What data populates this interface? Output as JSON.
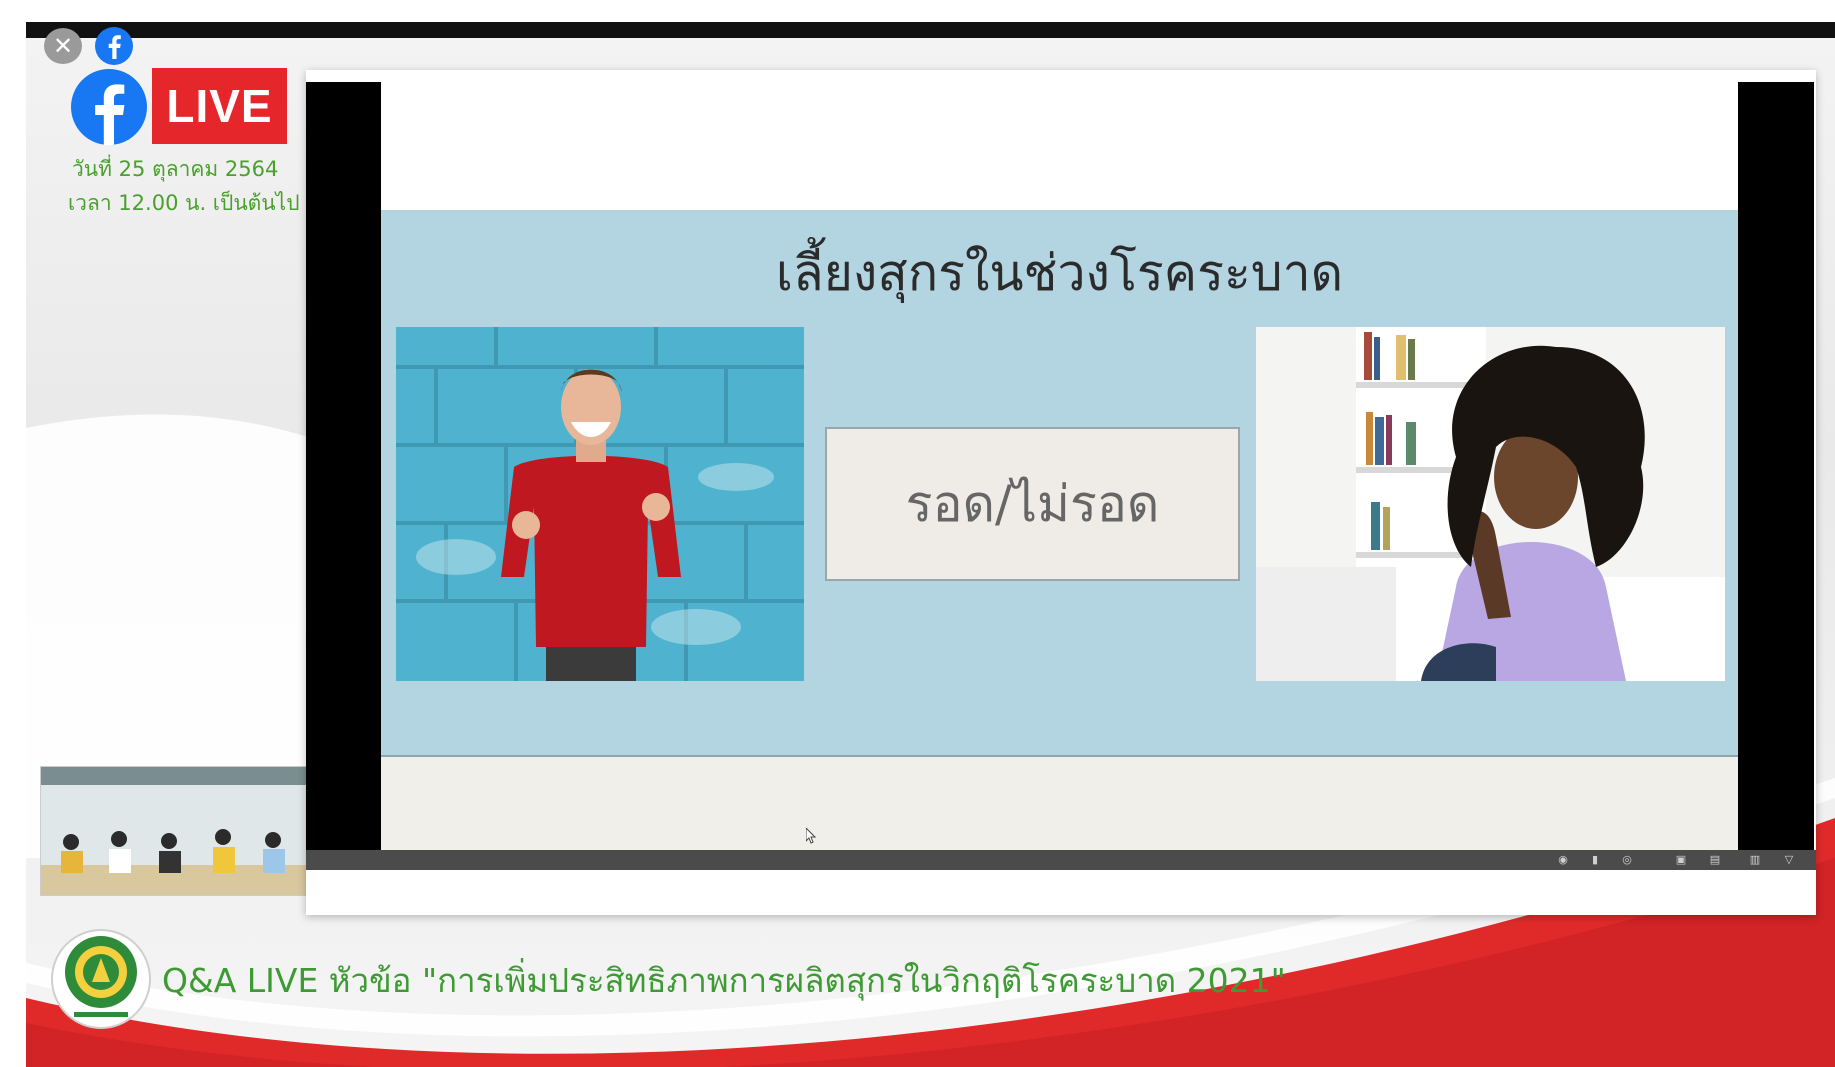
{
  "overlay": {
    "close_glyph": "✕",
    "live_badge": "LIVE",
    "date_line_1": "วันที่ 25 ตุลาคม 2564",
    "date_line_2": "เวลา 12.00 น. เป็นต้นไป",
    "colors": {
      "facebook_blue": "#1877f2",
      "live_red": "#e5262a",
      "accent_green": "#4aa02c",
      "swoosh_red": "#e02a2a"
    }
  },
  "slide": {
    "title": "เลี้ยงสุกรในช่วงโรคระบาด",
    "center_label": "รอด/ไม่รอด",
    "background_color": "#b3d5e2"
  },
  "viewer_controls": {
    "icons": [
      "zoom-icon",
      "pause-icon",
      "record-icon",
      "save-icon",
      "grid-icon",
      "menu-icon",
      "fullscreen-icon"
    ]
  },
  "footer": {
    "caption": "Q&A LIVE หัวข้อ \"การเพิ่มประสิทธิภาพการผลิตสุกรในวิกฤติโรคระบาด 2021\""
  }
}
